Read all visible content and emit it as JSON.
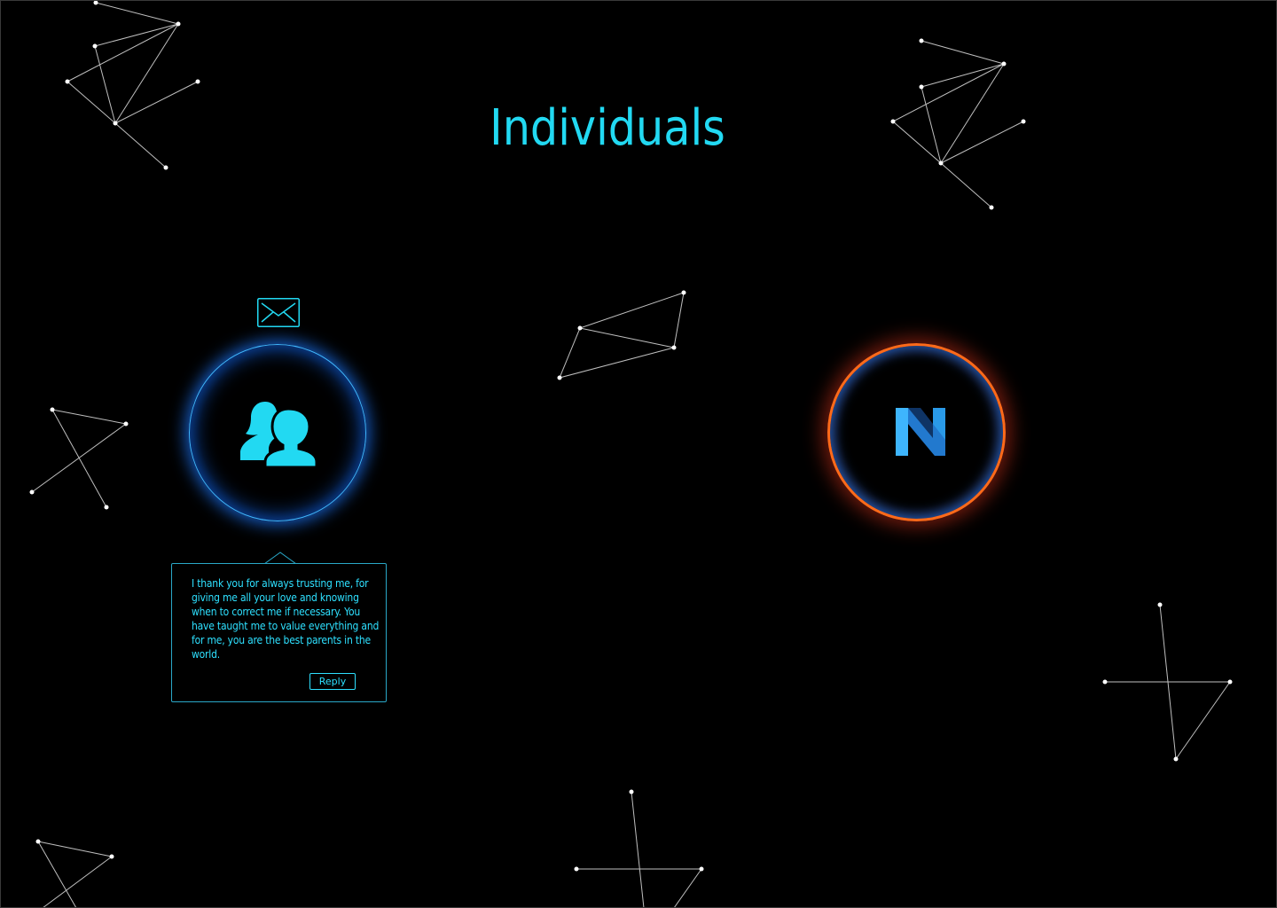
{
  "page": {
    "title": "Individuals"
  },
  "colors": {
    "accent": "#22d9f2",
    "background": "#000000",
    "avatar_glow": "#1e78ff",
    "brand_ring": "#ff6a1a",
    "brand_logo": "#2a8fe0",
    "constellation_line": "#bfbfbf"
  },
  "icons": {
    "mail": "envelope-icon",
    "avatar": "users-icon",
    "brand": "n-logo-icon"
  },
  "message": {
    "text": "I thank you for always trusting me, for giving me all your love and knowing when to correct me if necessary. You have taught me to value everything and for me, you are the best parents in the world.",
    "reply_label": "Reply"
  }
}
